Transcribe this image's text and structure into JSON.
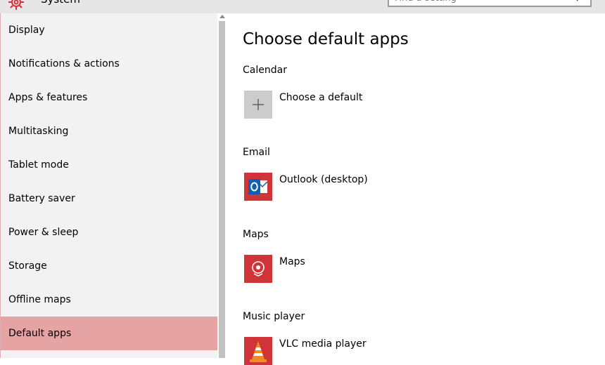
{
  "window": {
    "title": "System",
    "search_placeholder": "Find a setting"
  },
  "sidebar": {
    "items": [
      {
        "label": "Display"
      },
      {
        "label": "Notifications & actions"
      },
      {
        "label": "Apps & features"
      },
      {
        "label": "Multitasking"
      },
      {
        "label": "Tablet mode"
      },
      {
        "label": "Battery saver"
      },
      {
        "label": "Power & sleep"
      },
      {
        "label": "Storage"
      },
      {
        "label": "Offline maps"
      },
      {
        "label": "Default apps"
      }
    ],
    "selected_index": 9
  },
  "main": {
    "title": "Choose default apps",
    "sections": [
      {
        "label": "Calendar",
        "app": "Choose a default",
        "icon": "plus-icon"
      },
      {
        "label": "Email",
        "app": "Outlook (desktop)",
        "icon": "outlook-icon"
      },
      {
        "label": "Maps",
        "app": "Maps",
        "icon": "maps-icon"
      },
      {
        "label": "Music player",
        "app": "VLC media player",
        "icon": "vlc-icon"
      }
    ]
  },
  "colors": {
    "accent": "#e5a3a3",
    "tile_red": "#d13438",
    "tile_gray": "#cccccc",
    "sidebar_bg": "#f2f2f2"
  }
}
